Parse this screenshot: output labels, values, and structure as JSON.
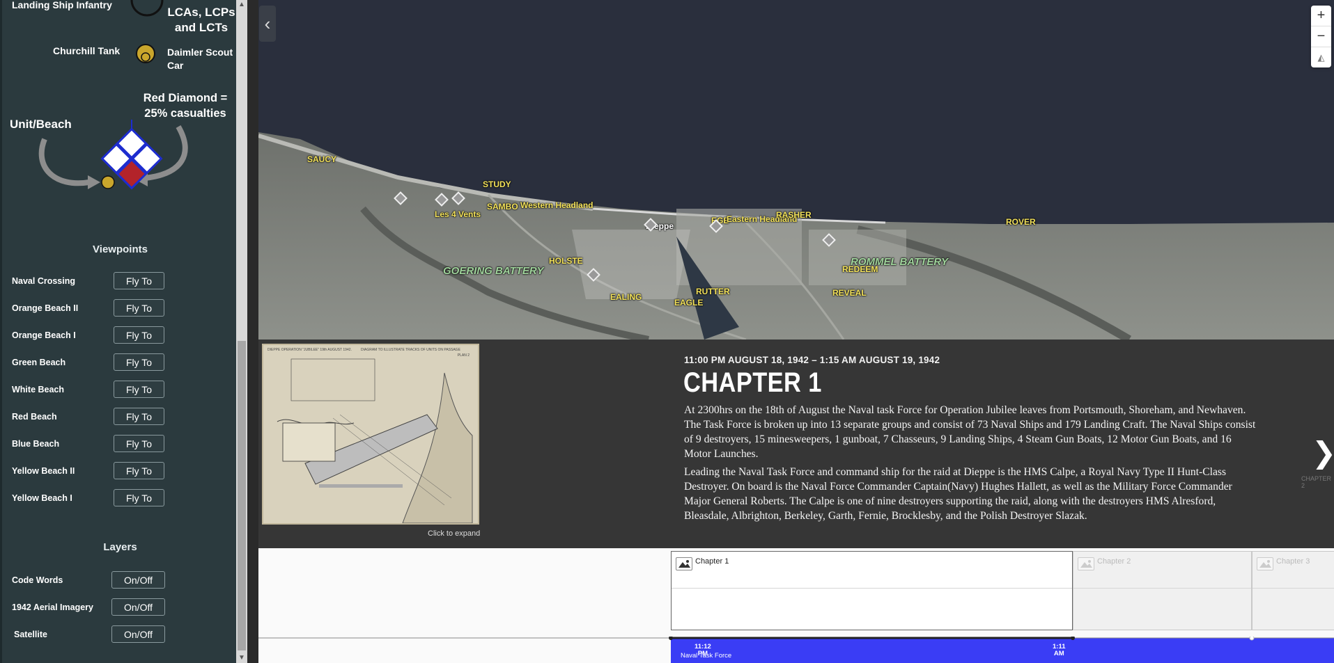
{
  "legend": {
    "landing_ship_infantry": "Landing Ship Infantry",
    "lcas": "LCAs, LCPs",
    "lcas2": "and LCTs",
    "churchill": "Churchill Tank",
    "daimler1": "Daimler Scout",
    "daimler2": "Car",
    "red_diamond1": "Red Diamond =",
    "red_diamond2": "25% casualties",
    "unit_beach": "Unit/Beach"
  },
  "viewpoints": {
    "title": "Viewpoints",
    "button_label": "Fly To",
    "items": [
      "Naval Crossing",
      "Orange Beach II",
      "Orange Beach I",
      "Green Beach",
      "White Beach",
      "Red Beach",
      "Blue Beach",
      "Yellow Beach II",
      "Yellow Beach I"
    ]
  },
  "layers": {
    "title": "Layers",
    "button_label": "On/Off",
    "items": [
      "Code Words",
      "1942 Aerial Imagery",
      "Satellite"
    ]
  },
  "map": {
    "labels": [
      {
        "t": "SAUCY",
        "c": "yellow"
      },
      {
        "t": "STUDY",
        "c": "yellow"
      },
      {
        "t": "SAMBO",
        "c": "yellow"
      },
      {
        "t": "Western Headland",
        "c": "yellow"
      },
      {
        "t": "Les 4 Vents",
        "c": "yellow"
      },
      {
        "t": "Dieppe",
        "c": "white"
      },
      {
        "t": "EGE",
        "c": "yellow"
      },
      {
        "t": "Eastern Headland",
        "c": "yellow"
      },
      {
        "t": "RASHER",
        "c": "yellow"
      },
      {
        "t": "ROVER",
        "c": "yellow"
      },
      {
        "t": "GOERING BATTERY",
        "c": "green"
      },
      {
        "t": "HOLSTE",
        "c": "yellow"
      },
      {
        "t": "ROMMEL BATTERY",
        "c": "green"
      },
      {
        "t": "REDEEM",
        "c": "yellow"
      },
      {
        "t": "EALING",
        "c": "yellow"
      },
      {
        "t": "RUTTER",
        "c": "yellow"
      },
      {
        "t": "EAGLE",
        "c": "yellow"
      },
      {
        "t": "REVEAL",
        "c": "yellow"
      }
    ],
    "zoom_in": "+",
    "zoom_out": "−",
    "collapse": "‹"
  },
  "story": {
    "expand_label": "Click to expand",
    "date": "11:00 PM AUGUST 18, 1942 – 1:15 AM AUGUST 19, 1942",
    "title": "CHAPTER 1",
    "p1": "At 2300hrs on the 18th of August the Naval task Force for Operation Jubilee leaves from Portsmouth, Shoreham, and Newhaven. The Task Force is broken up into 13 separate groups and consist of 73 Naval Ships and 179 Landing Craft. The Naval Ships consist of 9 destroyers, 15 minesweepers, 1 gunboat, 7 Chasseurs, 9 Landing Ships, 4 Steam Gun Boats, 12 Motor Gun Boats, and 16 Motor Launches.",
    "p2": "Leading the Naval Task Force and command ship for the raid at Dieppe is the HMS Calpe, a Royal Navy Type II Hunt-Class Destroyer. On board is the Naval Force Commander Captain(Navy) Hughes Hallett, as well as the Military Force Commander Major General Roberts. The Calpe is one of nine destroyers supporting the raid, along with the destroyers HMS Alresford, Bleasdale, Albrighton, Berkeley, Garth, Fernie, Brocklesby, and the Polish Destroyer Slazak.",
    "next_label": "CHAPTER 2",
    "map_title": "DIEPPE OPERATION \"JUBILEE\" 19th AUGUST 1942.",
    "map_subtitle": "DIAGRAM TO ILLUSTRATE TRACKS OF UNITS ON PASSAGE",
    "map_plan": "PLAN 2"
  },
  "timeline": {
    "chapters": [
      "Chapter 1",
      "Chapter 2",
      "Chapter 3"
    ],
    "t1a": "11:12",
    "t1b": "PM",
    "t2a": "1:11",
    "t2b": "AM",
    "event": "Naval Task Force"
  }
}
